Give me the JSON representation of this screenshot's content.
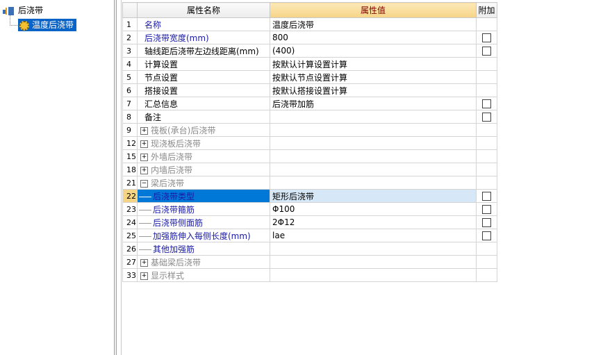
{
  "tree": {
    "root_label": "后浇带",
    "child_label": "温度后浇带"
  },
  "grid": {
    "headers": {
      "name": "属性名称",
      "value": "属性值",
      "extra": "附加"
    },
    "rows": [
      {
        "num": "1",
        "name": "名称",
        "value": "温度后浇带",
        "style": "blue",
        "check": false,
        "expander": "",
        "indent": false
      },
      {
        "num": "2",
        "name": "后浇带宽度(mm)",
        "value": "800",
        "style": "blue",
        "check": true,
        "expander": "",
        "indent": false
      },
      {
        "num": "3",
        "name": "轴线距后浇带左边线距离(mm)",
        "value": "(400)",
        "style": "normal",
        "check": true,
        "expander": "",
        "indent": false
      },
      {
        "num": "4",
        "name": "计算设置",
        "value": "按默认计算设置计算",
        "style": "normal",
        "check": false,
        "expander": "",
        "indent": false
      },
      {
        "num": "5",
        "name": "节点设置",
        "value": "按默认节点设置计算",
        "style": "normal",
        "check": false,
        "expander": "",
        "indent": false
      },
      {
        "num": "6",
        "name": "搭接设置",
        "value": "按默认搭接设置计算",
        "style": "normal",
        "check": false,
        "expander": "",
        "indent": false
      },
      {
        "num": "7",
        "name": "汇总信息",
        "value": "后浇带加筋",
        "style": "normal",
        "check": true,
        "expander": "",
        "indent": false
      },
      {
        "num": "8",
        "name": "备注",
        "value": "",
        "style": "normal",
        "check": true,
        "expander": "",
        "indent": false
      },
      {
        "num": "9",
        "name": "筏板(承台)后浇带",
        "value": "",
        "style": "gray",
        "check": false,
        "expander": "+",
        "indent": false
      },
      {
        "num": "12",
        "name": "现浇板后浇带",
        "value": "",
        "style": "gray",
        "check": false,
        "expander": "+",
        "indent": false
      },
      {
        "num": "15",
        "name": "外墙后浇带",
        "value": "",
        "style": "gray",
        "check": false,
        "expander": "+",
        "indent": false
      },
      {
        "num": "18",
        "name": "内墙后浇带",
        "value": "",
        "style": "gray",
        "check": false,
        "expander": "+",
        "indent": false
      },
      {
        "num": "21",
        "name": "梁后浇带",
        "value": "",
        "style": "gray",
        "check": false,
        "expander": "−",
        "indent": false
      },
      {
        "num": "22",
        "name": "后浇带类型",
        "value": "矩形后浇带",
        "style": "blue",
        "check": true,
        "expander": "",
        "indent": true,
        "selected": true
      },
      {
        "num": "23",
        "name": "后浇带箍筋",
        "value": "Φ100",
        "style": "blue",
        "check": true,
        "expander": "",
        "indent": true
      },
      {
        "num": "24",
        "name": "后浇带侧面筋",
        "value": "2Φ12",
        "style": "blue",
        "check": true,
        "expander": "",
        "indent": true
      },
      {
        "num": "25",
        "name": "加强筋伸入每侧长度(mm)",
        "value": "lae",
        "style": "blue",
        "check": true,
        "expander": "",
        "indent": true
      },
      {
        "num": "26",
        "name": "其他加强筋",
        "value": "",
        "style": "blue",
        "check": false,
        "expander": "",
        "indent": true
      },
      {
        "num": "27",
        "name": "基础梁后浇带",
        "value": "",
        "style": "gray",
        "check": false,
        "expander": "+",
        "indent": false
      },
      {
        "num": "33",
        "name": "显示样式",
        "value": "",
        "style": "gray",
        "check": false,
        "expander": "+",
        "indent": false
      }
    ]
  }
}
